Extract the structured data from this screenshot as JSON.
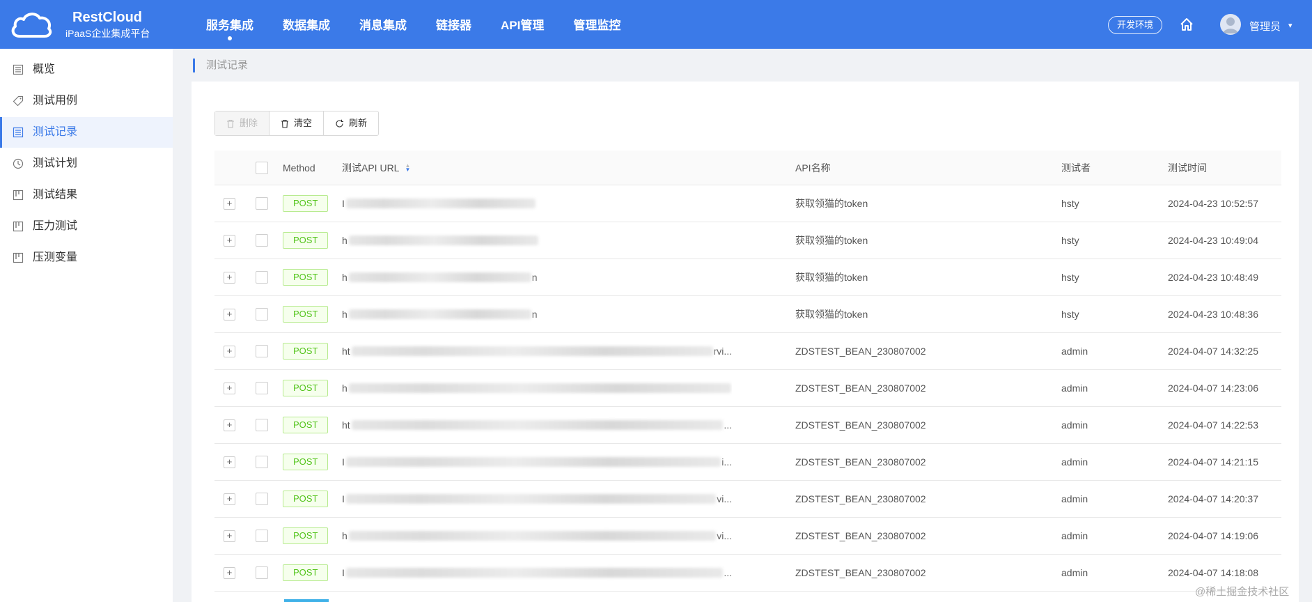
{
  "app": {
    "name": "RestCloud",
    "subtitle": "iPaaS企业集成平台"
  },
  "nav": [
    {
      "label": "服务集成",
      "active": true
    },
    {
      "label": "数据集成",
      "active": false
    },
    {
      "label": "消息集成",
      "active": false
    },
    {
      "label": "链接器",
      "active": false
    },
    {
      "label": "API管理",
      "active": false
    },
    {
      "label": "管理监控",
      "active": false
    }
  ],
  "header": {
    "env_label": "开发环境",
    "user_name": "管理员",
    "home_icon": "home-icon",
    "caret": "▾"
  },
  "sidebar": {
    "items": [
      {
        "label": "概览",
        "icon": "list-icon",
        "active": false
      },
      {
        "label": "测试用例",
        "icon": "tag-icon",
        "active": false
      },
      {
        "label": "测试记录",
        "icon": "list-icon",
        "active": true
      },
      {
        "label": "测试计划",
        "icon": "clock-icon",
        "active": false
      },
      {
        "label": "测试结果",
        "icon": "board-icon",
        "active": false
      },
      {
        "label": "压力测试",
        "icon": "board-icon",
        "active": false
      },
      {
        "label": "压测变量",
        "icon": "board-icon",
        "active": false
      }
    ]
  },
  "breadcrumb": "测试记录",
  "toolbar": {
    "delete_label": "删除",
    "clear_label": "清空",
    "refresh_label": "刷新"
  },
  "table": {
    "columns": {
      "method": "Method",
      "url": "测试API URL",
      "name": "API名称",
      "tester": "测试者",
      "time": "测试时间"
    },
    "rows": [
      {
        "method": "POST",
        "url_start": "I",
        "url_tail": "",
        "api_name": "获取领猫的token",
        "tester": "hsty",
        "time": "2024-04-23 10:52:57"
      },
      {
        "method": "POST",
        "url_start": "h",
        "url_tail": "",
        "api_name": "获取领猫的token",
        "tester": "hsty",
        "time": "2024-04-23 10:49:04"
      },
      {
        "method": "POST",
        "url_start": "h",
        "url_tail": "n",
        "api_name": "获取领猫的token",
        "tester": "hsty",
        "time": "2024-04-23 10:48:49"
      },
      {
        "method": "POST",
        "url_start": "h",
        "url_tail": "n",
        "api_name": "获取领猫的token",
        "tester": "hsty",
        "time": "2024-04-23 10:48:36"
      },
      {
        "method": "POST",
        "url_start": "ht",
        "url_tail": "rvi...",
        "api_name": "ZDSTEST_BEAN_230807002",
        "tester": "admin",
        "time": "2024-04-07 14:32:25"
      },
      {
        "method": "POST",
        "url_start": "h",
        "url_tail": "",
        "api_name": "ZDSTEST_BEAN_230807002",
        "tester": "admin",
        "time": "2024-04-07 14:23:06"
      },
      {
        "method": "POST",
        "url_start": "ht",
        "url_tail": "...",
        "api_name": "ZDSTEST_BEAN_230807002",
        "tester": "admin",
        "time": "2024-04-07 14:22:53"
      },
      {
        "method": "POST",
        "url_start": "I",
        "url_tail": "i...",
        "api_name": "ZDSTEST_BEAN_230807002",
        "tester": "admin",
        "time": "2024-04-07 14:21:15"
      },
      {
        "method": "POST",
        "url_start": "I",
        "url_tail": "vi...",
        "api_name": "ZDSTEST_BEAN_230807002",
        "tester": "admin",
        "time": "2024-04-07 14:20:37"
      },
      {
        "method": "POST",
        "url_start": "h",
        "url_tail": "vi...",
        "api_name": "ZDSTEST_BEAN_230807002",
        "tester": "admin",
        "time": "2024-04-07 14:19:06"
      },
      {
        "method": "POST",
        "url_start": "I",
        "url_tail": "...",
        "api_name": "ZDSTEST_BEAN_230807002",
        "tester": "admin",
        "time": "2024-04-07 14:18:08"
      }
    ]
  },
  "watermark": "@稀土掘金技术社区",
  "colors": {
    "primary": "#3b7ae8",
    "tag_green": "#52c41a"
  }
}
